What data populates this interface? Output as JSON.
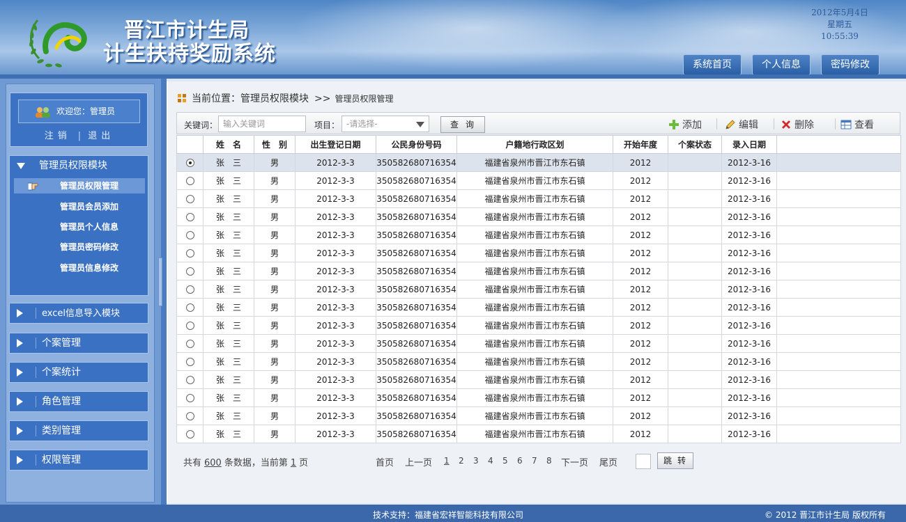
{
  "header": {
    "title_line1": "晋江市计生局",
    "title_line2": "计生扶持奖励系统",
    "date": "2012年5月4日",
    "weekday": "星期五",
    "time": "10:55:39",
    "nav": [
      {
        "label": "系统首页"
      },
      {
        "label": "个人信息"
      },
      {
        "label": "密码修改"
      }
    ]
  },
  "sidebar": {
    "welcome": "欢迎您：管理员",
    "logout_label": "注销",
    "exit_label": "退出",
    "expanded_module": {
      "label": "管理员权限模块",
      "items": [
        {
          "label": "管理员权限管理",
          "active": true
        },
        {
          "label": "管理员会员添加"
        },
        {
          "label": "管理员个人信息"
        },
        {
          "label": "管理员密码修改"
        },
        {
          "label": "管理员信息修改"
        }
      ]
    },
    "modules": [
      {
        "label": "excel信息导入模块"
      },
      {
        "label": "个案管理"
      },
      {
        "label": "个案统计"
      },
      {
        "label": "角色管理"
      },
      {
        "label": "类别管理"
      },
      {
        "label": "权限管理"
      }
    ]
  },
  "breadcrumb": {
    "prefix": "当前位置：管理员权限模块",
    "separator": ">>",
    "current": "管理员权限管理"
  },
  "toolbar": {
    "keyword_label": "关键词：",
    "keyword_placeholder": "输入关键词",
    "project_label": "项目：",
    "project_selected": "-请选择-",
    "query_label": "查询",
    "add_label": "添加",
    "edit_label": "编辑",
    "delete_label": "删除",
    "view_label": "查看"
  },
  "table": {
    "columns": [
      "",
      "姓　名",
      "性　别",
      "出生登记日期",
      "公民身份号码",
      "户籍地行政区划",
      "开始年度",
      "个案状态",
      "录入日期",
      ""
    ],
    "selected_row": 0,
    "rows": [
      [
        "张　三",
        "男",
        "2012-3-3",
        "350582680716354",
        "福建省泉州市晋江市东石镇",
        "2012",
        "",
        "2012-3-16"
      ],
      [
        "张　三",
        "男",
        "2012-3-3",
        "350582680716354",
        "福建省泉州市晋江市东石镇",
        "2012",
        "",
        "2012-3-16"
      ],
      [
        "张　三",
        "男",
        "2012-3-3",
        "350582680716354",
        "福建省泉州市晋江市东石镇",
        "2012",
        "",
        "2012-3-16"
      ],
      [
        "张　三",
        "男",
        "2012-3-3",
        "350582680716354",
        "福建省泉州市晋江市东石镇",
        "2012",
        "",
        "2012-3-16"
      ],
      [
        "张　三",
        "男",
        "2012-3-3",
        "350582680716354",
        "福建省泉州市晋江市东石镇",
        "2012",
        "",
        "2012-3-16"
      ],
      [
        "张　三",
        "男",
        "2012-3-3",
        "350582680716354",
        "福建省泉州市晋江市东石镇",
        "2012",
        "",
        "2012-3-16"
      ],
      [
        "张　三",
        "男",
        "2012-3-3",
        "350582680716354",
        "福建省泉州市晋江市东石镇",
        "2012",
        "",
        "2012-3-16"
      ],
      [
        "张　三",
        "男",
        "2012-3-3",
        "350582680716354",
        "福建省泉州市晋江市东石镇",
        "2012",
        "",
        "2012-3-16"
      ],
      [
        "张　三",
        "男",
        "2012-3-3",
        "350582680716354",
        "福建省泉州市晋江市东石镇",
        "2012",
        "",
        "2012-3-16"
      ],
      [
        "张　三",
        "男",
        "2012-3-3",
        "350582680716354",
        "福建省泉州市晋江市东石镇",
        "2012",
        "",
        "2012-3-16"
      ],
      [
        "张　三",
        "男",
        "2012-3-3",
        "350582680716354",
        "福建省泉州市晋江市东石镇",
        "2012",
        "",
        "2012-3-16"
      ],
      [
        "张　三",
        "男",
        "2012-3-3",
        "350582680716354",
        "福建省泉州市晋江市东石镇",
        "2012",
        "",
        "2012-3-16"
      ],
      [
        "张　三",
        "男",
        "2012-3-3",
        "350582680716354",
        "福建省泉州市晋江市东石镇",
        "2012",
        "",
        "2012-3-16"
      ],
      [
        "张　三",
        "男",
        "2012-3-3",
        "350582680716354",
        "福建省泉州市晋江市东石镇",
        "2012",
        "",
        "2012-3-16"
      ],
      [
        "张　三",
        "男",
        "2012-3-3",
        "350582680716354",
        "福建省泉州市晋江市东石镇",
        "2012",
        "",
        "2012-3-16"
      ],
      [
        "张　三",
        "男",
        "2012-3-3",
        "350582680716354",
        "福建省泉州市晋江市东石镇",
        "2012",
        "",
        "2012-3-16"
      ]
    ]
  },
  "pager": {
    "prefix": "共有",
    "total": "600",
    "middle": "条数据，当前第",
    "current": "1",
    "suffix": "页",
    "first": "首页",
    "prev": "上一页",
    "pages": [
      "1",
      "2",
      "3",
      "4",
      "5",
      "6",
      "7",
      "8"
    ],
    "next": "下一页",
    "last": "尾页",
    "jump_label": "跳转"
  },
  "footer": {
    "support": "技术支持：福建省宏祥智能科技有限公司",
    "copyright": "© 2012  晋江市计生局   版权所有"
  },
  "colors": {
    "header_blue": "#4f86c6",
    "sidebar_module": "#3a71c3",
    "footer_bar": "#3b68ab",
    "selected_row": "#dde3ec"
  }
}
